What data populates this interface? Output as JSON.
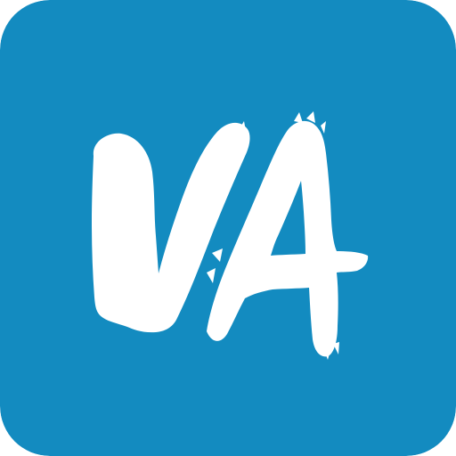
{
  "app_icon": {
    "logo_text": "VA",
    "background_color": "#138BC0",
    "glyph_color": "#FFFFFF",
    "icon_name": "va-brush-logo-icon"
  }
}
